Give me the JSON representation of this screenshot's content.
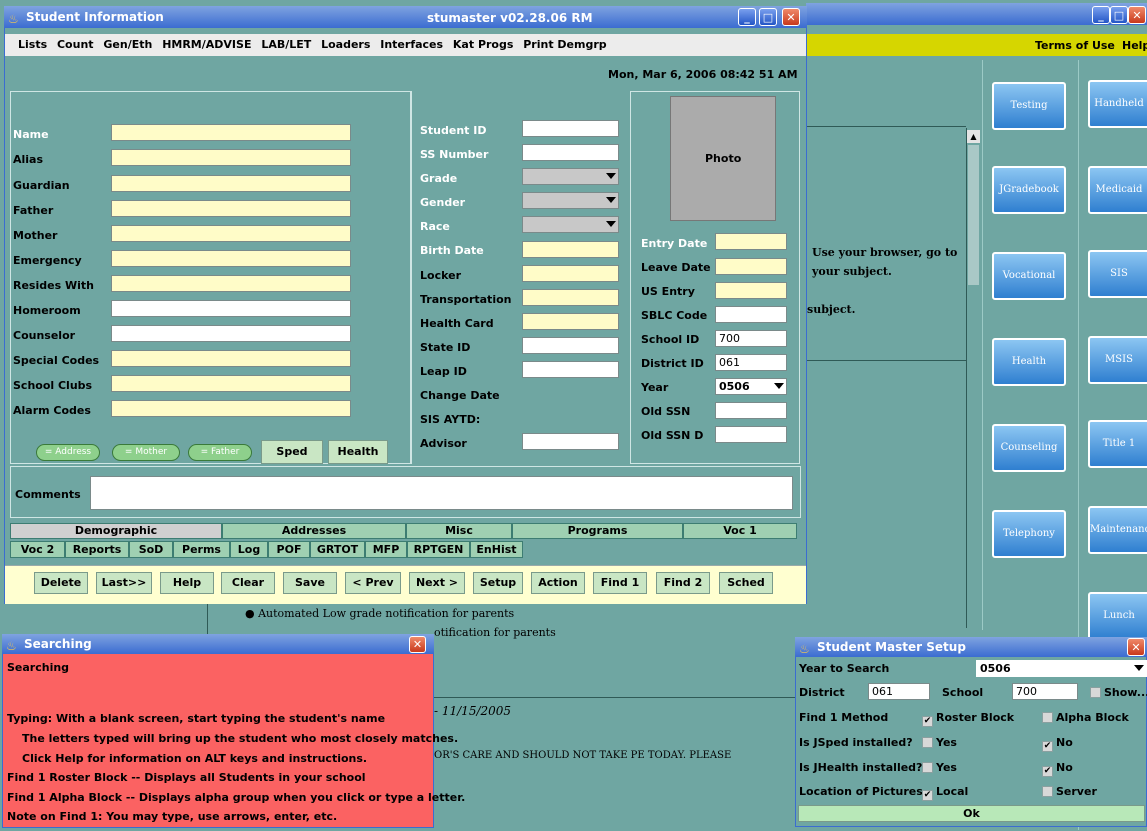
{
  "bg_window": {
    "terms": "Terms of Use",
    "help": "Help",
    "body_lines": [
      "Use your browser, go to",
      "your subject.",
      "subject."
    ],
    "footer_items": [
      "Automated Low grade notification for parents",
      "Automated Low grade notification for parents"
    ],
    "date_line": "- 11/15/2005",
    "notice": "OR'S CARE AND SHOULD NOT TAKE PE TODAY. PLEASE",
    "left_buttons": [
      "Testing",
      "JGradebook",
      "Vocational",
      "Health",
      "Counseling",
      "Telephony"
    ],
    "right_buttons": [
      "Handheld",
      "Medicaid",
      "SIS",
      "MSIS",
      "Title 1",
      "Maintenance",
      "Lunch"
    ]
  },
  "main_window": {
    "title": "Student Information",
    "version": "stumaster v02.28.06 RM",
    "menu": [
      "Lists",
      "Count",
      "Gen/Eth",
      "HMRM/ADVISE",
      "LAB/LET",
      "Loaders",
      "Interfaces",
      "Kat Progs",
      "Print Demgrp"
    ],
    "datetime": "Mon, Mar 6, 2006 08:42 51 AM",
    "left_labels": [
      "Name",
      "Alias",
      "Guardian",
      "Father",
      "Mother",
      "Emergency",
      "Resides With",
      "Homeroom",
      "Counselor",
      "Special Codes",
      "School Clubs",
      "Alarm Codes"
    ],
    "mid_labels": [
      "Student ID",
      "SS Number",
      "Grade",
      "Gender",
      "Race",
      "Birth Date",
      "Locker",
      "Transportation",
      "Health Card",
      "State ID",
      "Leap ID",
      "Change Date",
      "SIS AYTD:",
      "Advisor"
    ],
    "photo": "Photo",
    "right_labels": [
      "Entry Date",
      "Leave Date",
      "US Entry",
      "SBLC Code",
      "School ID",
      "District ID",
      "Year",
      "Old SSN",
      "Old SSN D"
    ],
    "school_id": "700",
    "district_id": "061",
    "year": "0506",
    "pills": [
      "= Address",
      "= Mother",
      "= Father"
    ],
    "sped": "Sped",
    "health": "Health",
    "comments": "Comments",
    "tabs_row1": [
      "Demographic",
      "Addresses",
      "Misc",
      "Programs",
      "Voc 1"
    ],
    "tabs_row2": [
      "Voc 2",
      "Reports",
      "SoD",
      "Perms",
      "Log",
      "POF",
      "GRTOT",
      "MFP",
      "RPTGEN",
      "EnHist"
    ],
    "buttons": [
      "Delete",
      "Last>>",
      "Help",
      "Clear",
      "Save",
      "< Prev",
      "Next >",
      "Setup",
      "Action",
      "Find 1",
      "Find 2",
      "Sched"
    ]
  },
  "searching": {
    "title": "Searching",
    "heading": "Searching",
    "lines": [
      "Typing: With a blank screen, start typing the student's name",
      "The letters typed will bring up the student who most closely matches.",
      "Click Help for information on ALT keys and instructions.",
      "Find 1 Roster Block -- Displays all Students in your school",
      "Find 1 Alpha Block  -- Displays alpha group when you click or type a letter.",
      "Note on Find 1: You may type, use arrows, enter, etc."
    ]
  },
  "setup": {
    "title": "Student Master Setup",
    "year_label": "Year to Search",
    "year_value": "0506",
    "district_label": "District",
    "district_value": "061",
    "school_label": "School",
    "school_value": "700",
    "show_label": "Show...",
    "find_label": "Find 1 Method",
    "roster": "Roster Block",
    "alpha": "Alpha Block",
    "jsped_label": "Is JSped installed?",
    "jhealth_label": "Is JHealth installed?",
    "yes": "Yes",
    "no": "No",
    "pictures_label": "Location of Pictures",
    "local": "Local",
    "server": "Server",
    "ok": "Ok"
  }
}
